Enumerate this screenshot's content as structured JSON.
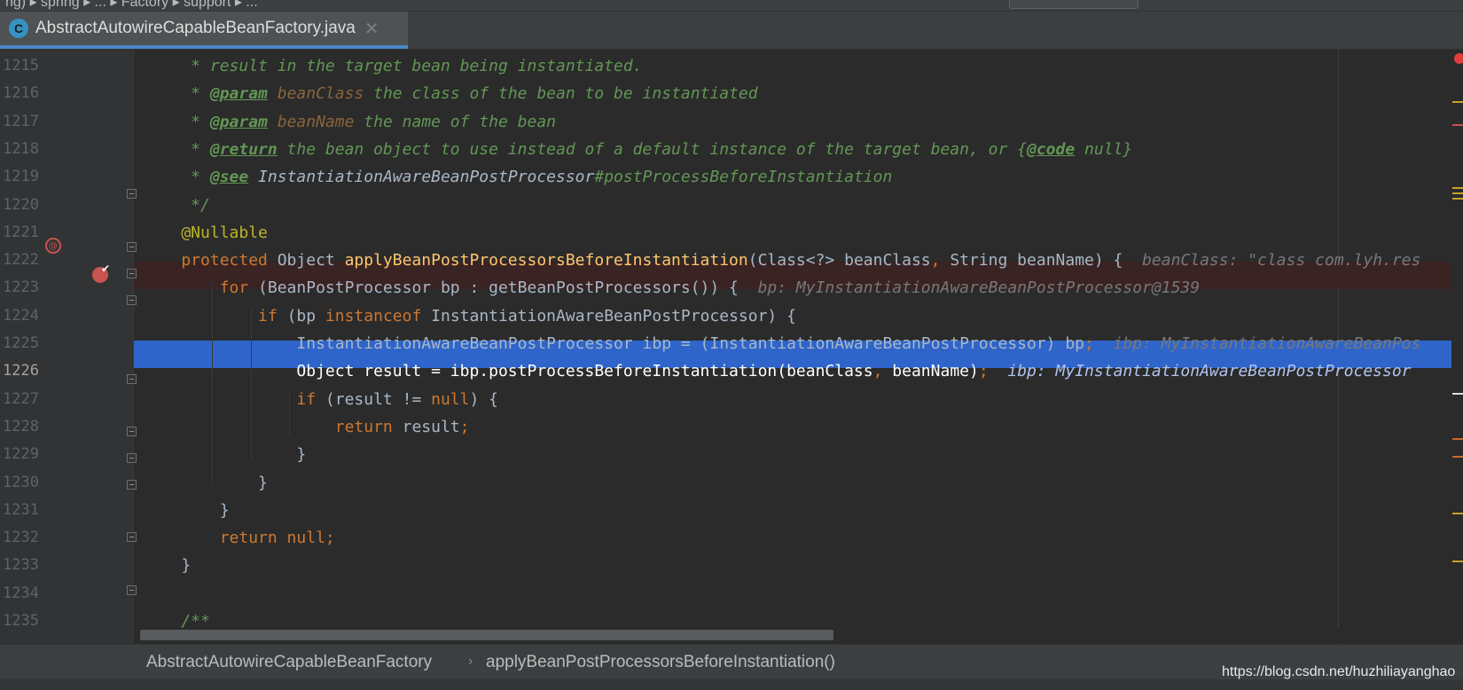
{
  "topbar": {
    "text": "ng) ▸ spring ▸ ... ▸ Factory ▸ support ▸ ..."
  },
  "tab": {
    "label": "AbstractAutowireCapableBeanFactory.java",
    "icon": "class-icon",
    "icon_letter": "C",
    "close": "✕"
  },
  "colors": {
    "accent": "#4a88c7",
    "selection": "#2f65ca",
    "breakpoint": "#c75450",
    "breakpoint_line": "#3a2323"
  },
  "lines": [
    {
      "num": "1215",
      "segs": [
        [
          "c-doc",
          "     * result in the target bean being instantiated."
        ]
      ]
    },
    {
      "num": "1216",
      "segs": [
        [
          "c-doc",
          "     * "
        ],
        [
          "c-tag",
          "@param"
        ],
        [
          "c-doc",
          " "
        ],
        [
          "c-param",
          "beanClass"
        ],
        [
          "c-doc",
          " the class of the bean to be instantiated"
        ]
      ]
    },
    {
      "num": "1217",
      "segs": [
        [
          "c-doc",
          "     * "
        ],
        [
          "c-tag",
          "@param"
        ],
        [
          "c-doc",
          " "
        ],
        [
          "c-param",
          "beanName"
        ],
        [
          "c-doc",
          " the name of the bean"
        ]
      ]
    },
    {
      "num": "1218",
      "segs": [
        [
          "c-doc",
          "     * "
        ],
        [
          "c-tag",
          "@return"
        ],
        [
          "c-doc",
          " the bean object to use instead of a default instance of the target bean, or {"
        ],
        [
          "c-tag",
          "@code"
        ],
        [
          "c-doc",
          " null}"
        ]
      ]
    },
    {
      "num": "1219",
      "segs": [
        [
          "c-doc",
          "     * "
        ],
        [
          "c-tag",
          "@see"
        ],
        [
          "c-doc",
          " "
        ],
        [
          "c-ref",
          "InstantiationAwareBeanPostProcessor"
        ],
        [
          "c-doc",
          "#postProcessBeforeInstantiation"
        ]
      ]
    },
    {
      "num": "1220",
      "segs": [
        [
          "c-doc",
          "     */"
        ]
      ]
    },
    {
      "num": "1221",
      "segs": [
        [
          "ann",
          "    @Nullable"
        ]
      ]
    },
    {
      "num": "1222",
      "segs": [
        [
          "kw",
          "    protected "
        ],
        [
          "",
          "Object "
        ],
        [
          "fn",
          "applyBeanPostProcessorsBeforeInstantiation"
        ],
        [
          "",
          "(Class<?> beanClass"
        ],
        [
          "kw",
          ", "
        ],
        [
          "",
          "String beanName) {  "
        ],
        [
          "hint",
          "beanClass: \"class com.lyh.res"
        ]
      ]
    },
    {
      "num": "1223",
      "segs": [
        [
          "kw",
          "        for "
        ],
        [
          "",
          "(BeanPostProcessor bp : getBeanPostProcessors()) {  "
        ],
        [
          "hint",
          "bp: MyInstantiationAwareBeanPostProcessor@1539"
        ]
      ]
    },
    {
      "num": "1224",
      "segs": [
        [
          "kw",
          "            if "
        ],
        [
          "",
          "(bp "
        ],
        [
          "kw",
          "instanceof "
        ],
        [
          "",
          "InstantiationAwareBeanPostProcessor) {"
        ]
      ]
    },
    {
      "num": "1225",
      "segs": [
        [
          "",
          "                InstantiationAwareBeanPostProcessor ibp = (InstantiationAwareBeanPostProcessor) bp"
        ],
        [
          "kw",
          ";  "
        ],
        [
          "hint",
          "ibp: MyInstantiationAwareBeanPos"
        ]
      ]
    },
    {
      "num": "1226",
      "segs": [
        [
          "sel-text",
          "                Object result = ibp.postProcessBeforeInstantiation(beanClass"
        ],
        [
          "kw",
          ", "
        ],
        [
          "sel-text",
          "beanName)"
        ],
        [
          "kw",
          ";  "
        ],
        [
          "sel-hint",
          "ibp: MyInstantiationAwareBeanPostProcessor"
        ]
      ]
    },
    {
      "num": "1227",
      "segs": [
        [
          "kw",
          "                if "
        ],
        [
          "",
          "(result != "
        ],
        [
          "kw",
          "null"
        ],
        [
          "",
          ") {"
        ]
      ]
    },
    {
      "num": "1228",
      "segs": [
        [
          "kw",
          "                    return "
        ],
        [
          "",
          "result"
        ],
        [
          "kw",
          ";"
        ]
      ]
    },
    {
      "num": "1229",
      "segs": [
        [
          "",
          "                }"
        ]
      ]
    },
    {
      "num": "1230",
      "segs": [
        [
          "",
          "            }"
        ]
      ]
    },
    {
      "num": "1231",
      "segs": [
        [
          "",
          "        }"
        ]
      ]
    },
    {
      "num": "1232",
      "segs": [
        [
          "kw",
          "        return null;"
        ]
      ]
    },
    {
      "num": "1233",
      "segs": [
        [
          "",
          "    }"
        ]
      ]
    },
    {
      "num": "1234",
      "segs": [
        [
          "",
          ""
        ]
      ]
    },
    {
      "num": "1235",
      "segs": [
        [
          "c-doc",
          "    /**"
        ]
      ]
    }
  ],
  "breadcrumb": {
    "class_name": "AbstractAutowireCapableBeanFactory",
    "separator": "›",
    "method_name": "applyBeanPostProcessorsBeforeInstantiation()"
  },
  "watermark": "https://blog.csdn.net/huzhiliayanghao"
}
